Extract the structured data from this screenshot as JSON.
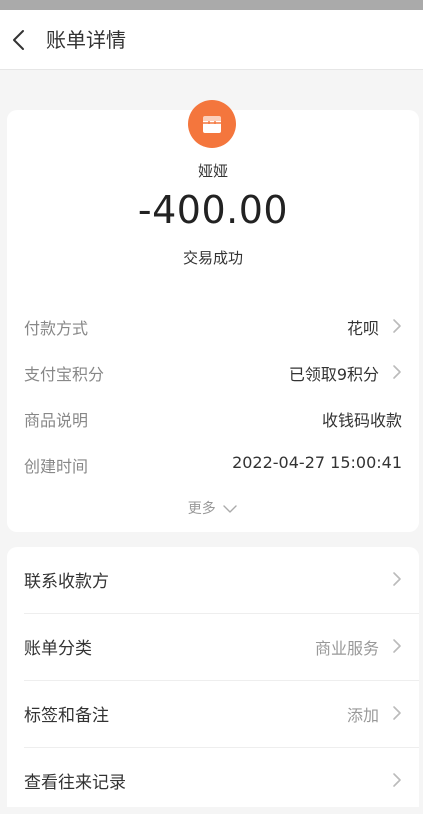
{
  "header": {
    "title": "账单详情"
  },
  "summary": {
    "payee": "娅娅",
    "amount": "-400.00",
    "status": "交易成功"
  },
  "details": [
    {
      "label": "付款方式",
      "value": "花呗"
    },
    {
      "label": "支付宝积分",
      "value": "已领取9积分"
    },
    {
      "label": "商品说明",
      "value": "收钱码收款"
    },
    {
      "label": "创建时间",
      "value": "2022-04-27 15:00:41"
    }
  ],
  "more_label": "更多",
  "actions": [
    {
      "label": "联系收款方",
      "value": ""
    },
    {
      "label": "账单分类",
      "value": "商业服务"
    },
    {
      "label": "标签和备注",
      "value": "添加"
    },
    {
      "label": "查看往来记录",
      "value": ""
    }
  ],
  "colors": {
    "avatar": "#f4763d",
    "background": "#f5f5f5"
  }
}
